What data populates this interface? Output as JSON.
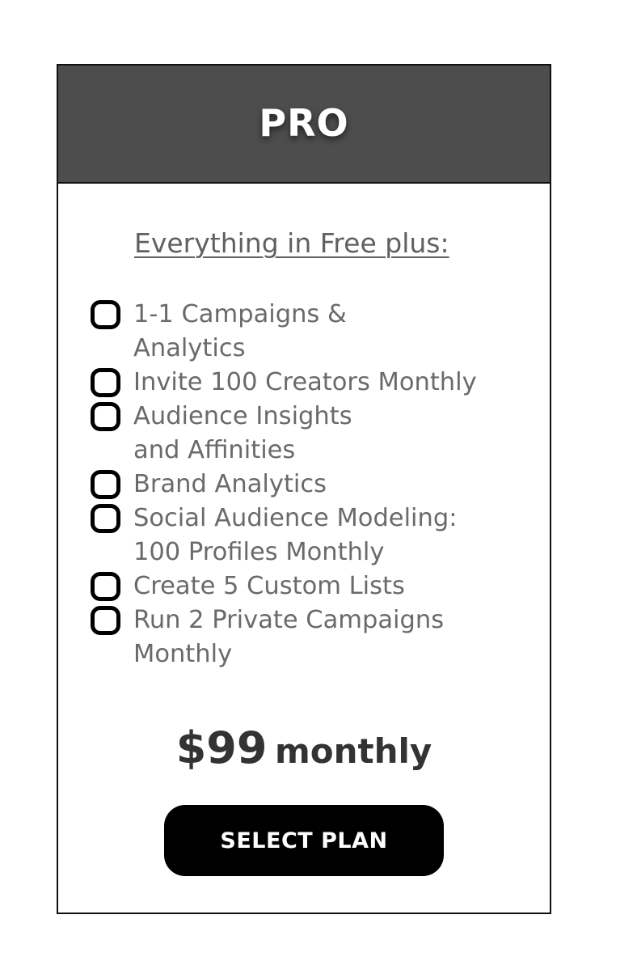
{
  "plan": {
    "title": "PRO",
    "intro": "Everything in Free plus:",
    "features": [
      {
        "icon": "rounded-square-bullet-icon",
        "label": "1-1 Campaigns &\nAnalytics"
      },
      {
        "icon": "rounded-square-bullet-icon",
        "label": "Invite 100 Creators Monthly"
      },
      {
        "icon": "rounded-square-bullet-icon",
        "label": "Audience Insights\nand Affinities"
      },
      {
        "icon": "rounded-square-bullet-icon",
        "label": "Brand Analytics"
      },
      {
        "icon": "rounded-square-bullet-icon",
        "label": "Social Audience Modeling:\n100 Profiles Monthly"
      },
      {
        "icon": "rounded-square-bullet-icon",
        "label": "Create 5 Custom Lists"
      },
      {
        "icon": "rounded-square-bullet-icon",
        "label": "Run 2 Private Campaigns\nMonthly"
      }
    ],
    "price": {
      "amount": "$99",
      "period": "monthly"
    },
    "button_label": "SELECT PLAN"
  },
  "colors": {
    "header_background": "#4d4d4d",
    "button_background": "#000000",
    "feature_text": "#6a6a6a",
    "price_text": "#333333"
  }
}
